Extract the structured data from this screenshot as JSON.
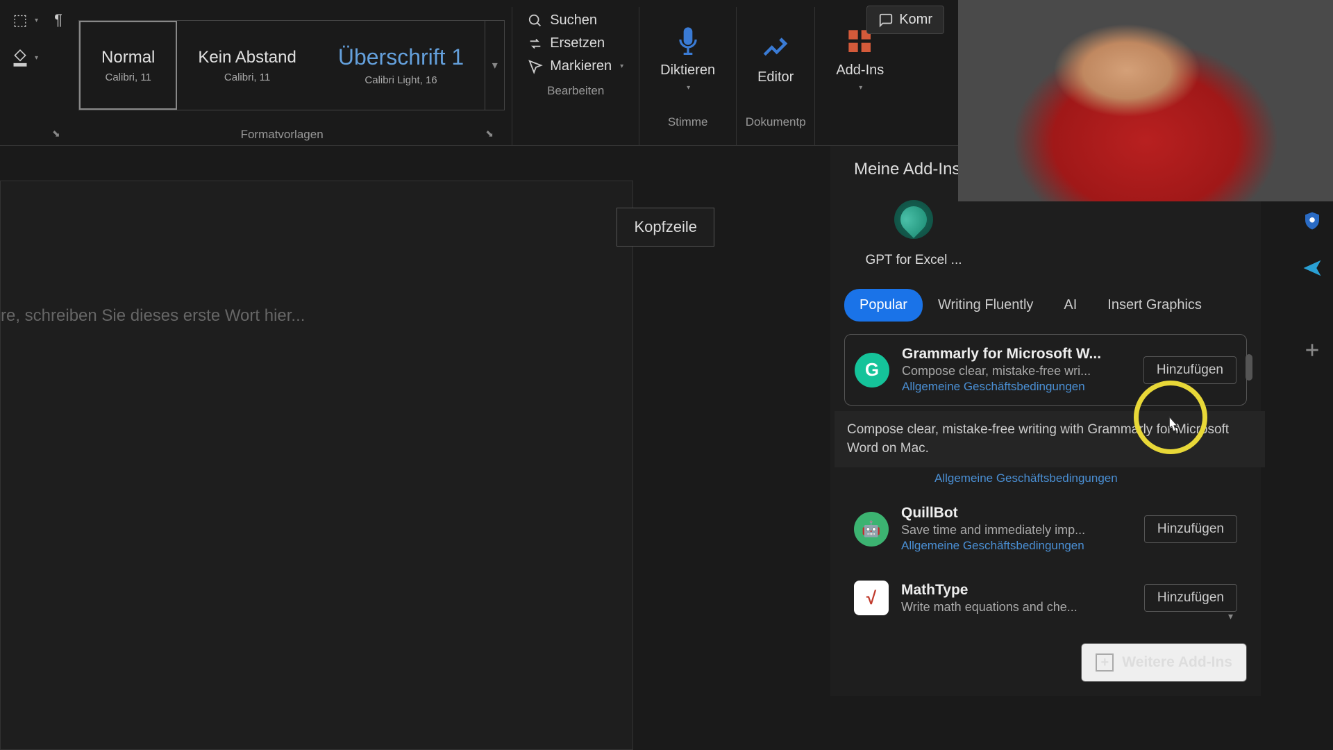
{
  "topbar": {
    "comments_label": "Komr"
  },
  "ribbon": {
    "styles": {
      "group_label": "Formatvorlagen",
      "items": [
        {
          "name": "Normal",
          "detail": "Calibri, 11"
        },
        {
          "name": "Kein Abstand",
          "detail": "Calibri, 11"
        },
        {
          "name": "Überschrift 1",
          "detail": "Calibri Light, 16"
        }
      ]
    },
    "edit": {
      "group_label": "Bearbeiten",
      "search": "Suchen",
      "replace": "Ersetzen",
      "select": "Markieren"
    },
    "dictate": {
      "label": "Diktieren",
      "group_label": "Stimme"
    },
    "editor": {
      "label": "Editor",
      "group_label": "Dokumentp"
    },
    "addins": {
      "label": "Add-Ins"
    }
  },
  "document": {
    "placeholder": "re, schreiben Sie dieses erste Wort hier...",
    "header_btn": "Kopfzeile"
  },
  "addins_panel": {
    "title": "Meine Add-Ins",
    "my_addin_label": "GPT for Excel ...",
    "tabs": [
      "Popular",
      "Writing Fluently",
      "AI",
      "Insert Graphics"
    ],
    "items": [
      {
        "name": "Grammarly for Microsoft W...",
        "desc": "Compose clear, mistake-free wri...",
        "terms": "Allgemeine Geschäftsbedingungen",
        "add": "Hinzufügen",
        "icon_letter": "G",
        "icon_bg": "#15c39a"
      },
      {
        "name": "QuillBot",
        "desc": "Save time and immediately imp...",
        "terms": "Allgemeine Geschäftsbedingungen",
        "add": "Hinzufügen",
        "icon_letter": "🤖",
        "icon_bg": "#3cb371"
      },
      {
        "name": "MathType",
        "desc": "Write math equations and che...",
        "terms": "",
        "add": "Hinzufügen",
        "icon_letter": "√",
        "icon_bg": "#ffffff"
      }
    ],
    "tooltip": "Compose clear, mistake-free writing with Grammarly for Microsoft Word on Mac.",
    "tooltip_terms": "Allgemeine Geschäftsbedingungen",
    "more_label": "Weitere Add-Ins"
  }
}
